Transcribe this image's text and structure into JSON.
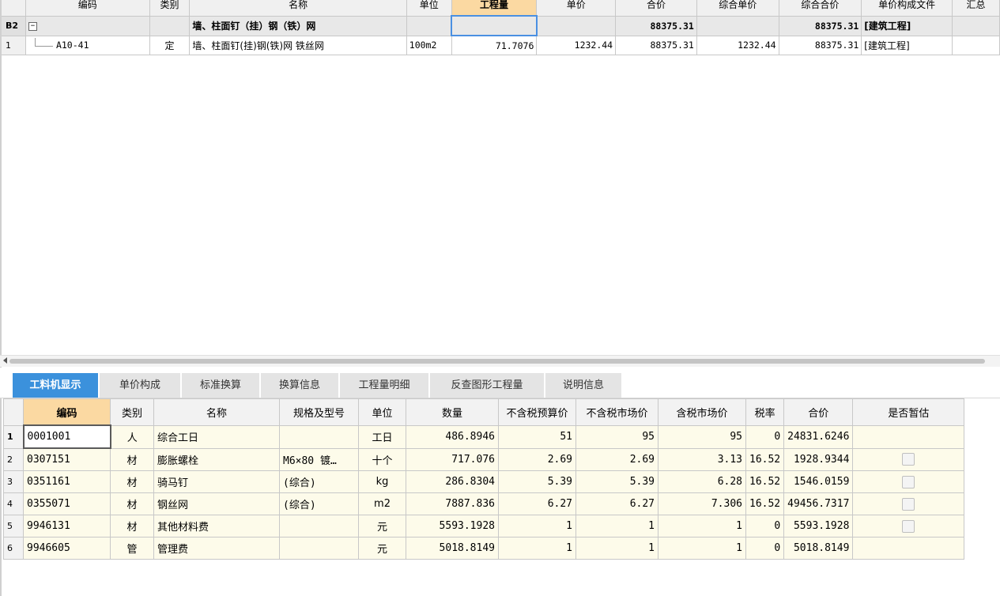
{
  "top_grid": {
    "columns": [
      "",
      "编码",
      "类别",
      "名称",
      "单位",
      "工程量",
      "单价",
      "合价",
      "综合单价",
      "综合合价",
      "单价构成文件",
      "汇总"
    ],
    "group_row": {
      "row_label": "B2",
      "toggle": "−",
      "name": "墙、柱面钉（挂）钢（铁）网",
      "total": "88375.31",
      "comprehensive_total": "88375.31",
      "cost_file": "[建筑工程]"
    },
    "item_row": {
      "row_label": "1",
      "code": "A10-41",
      "category": "定",
      "name": "墙、柱面钉(挂)钢(铁)网 铁丝网",
      "unit": "100m2",
      "quantity": "71.7076",
      "unit_price": "1232.44",
      "total": "88375.31",
      "comprehensive_unit_price": "1232.44",
      "comprehensive_total": "88375.31",
      "cost_file": "[建筑工程]"
    }
  },
  "tabs": [
    "工料机显示",
    "单价构成",
    "标准换算",
    "换算信息",
    "工程量明细",
    "反查图形工程量",
    "说明信息"
  ],
  "active_tab": 0,
  "bottom_grid": {
    "columns": [
      "",
      "编码",
      "类别",
      "名称",
      "规格及型号",
      "单位",
      "数量",
      "不含税预算价",
      "不含税市场价",
      "含税市场价",
      "税率",
      "合价",
      "是否暂估"
    ],
    "rows": [
      {
        "n": "1",
        "code": "0001001",
        "cat": "人",
        "name": "综合工日",
        "spec": "",
        "unit": "工日",
        "qty": "486.8946",
        "budget": "51",
        "market": "95",
        "tax_market": "95",
        "rate": "0",
        "total": "24831.6246",
        "est": false
      },
      {
        "n": "2",
        "code": "0307151",
        "cat": "材",
        "name": "膨胀螺栓",
        "spec": "M6×80 镀…",
        "unit": "十个",
        "qty": "717.076",
        "budget": "2.69",
        "market": "2.69",
        "tax_market": "3.13",
        "rate": "16.52",
        "total": "1928.9344",
        "est": true
      },
      {
        "n": "3",
        "code": "0351161",
        "cat": "材",
        "name": "骑马钉",
        "spec": "(综合)",
        "unit": "kg",
        "qty": "286.8304",
        "budget": "5.39",
        "market": "5.39",
        "tax_market": "6.28",
        "rate": "16.52",
        "total": "1546.0159",
        "est": true
      },
      {
        "n": "4",
        "code": "0355071",
        "cat": "材",
        "name": "钢丝网",
        "spec": "(综合)",
        "unit": "m2",
        "qty": "7887.836",
        "budget": "6.27",
        "market": "6.27",
        "tax_market": "7.306",
        "rate": "16.52",
        "total": "49456.7317",
        "est": true
      },
      {
        "n": "5",
        "code": "9946131",
        "cat": "材",
        "name": "其他材料费",
        "spec": "",
        "unit": "元",
        "qty": "5593.1928",
        "budget": "1",
        "market": "1",
        "tax_market": "1",
        "rate": "0",
        "total": "5593.1928",
        "est": true
      },
      {
        "n": "6",
        "code": "9946605",
        "cat": "管",
        "name": "管理费",
        "spec": "",
        "unit": "元",
        "qty": "5018.8149",
        "budget": "1",
        "market": "1",
        "tax_market": "1",
        "rate": "0",
        "total": "5018.8149",
        "est": false
      }
    ]
  },
  "colors": {
    "accent": "#3b91dc",
    "header_highlight": "#fbd9a2",
    "row_fill": "#fdfbea"
  }
}
